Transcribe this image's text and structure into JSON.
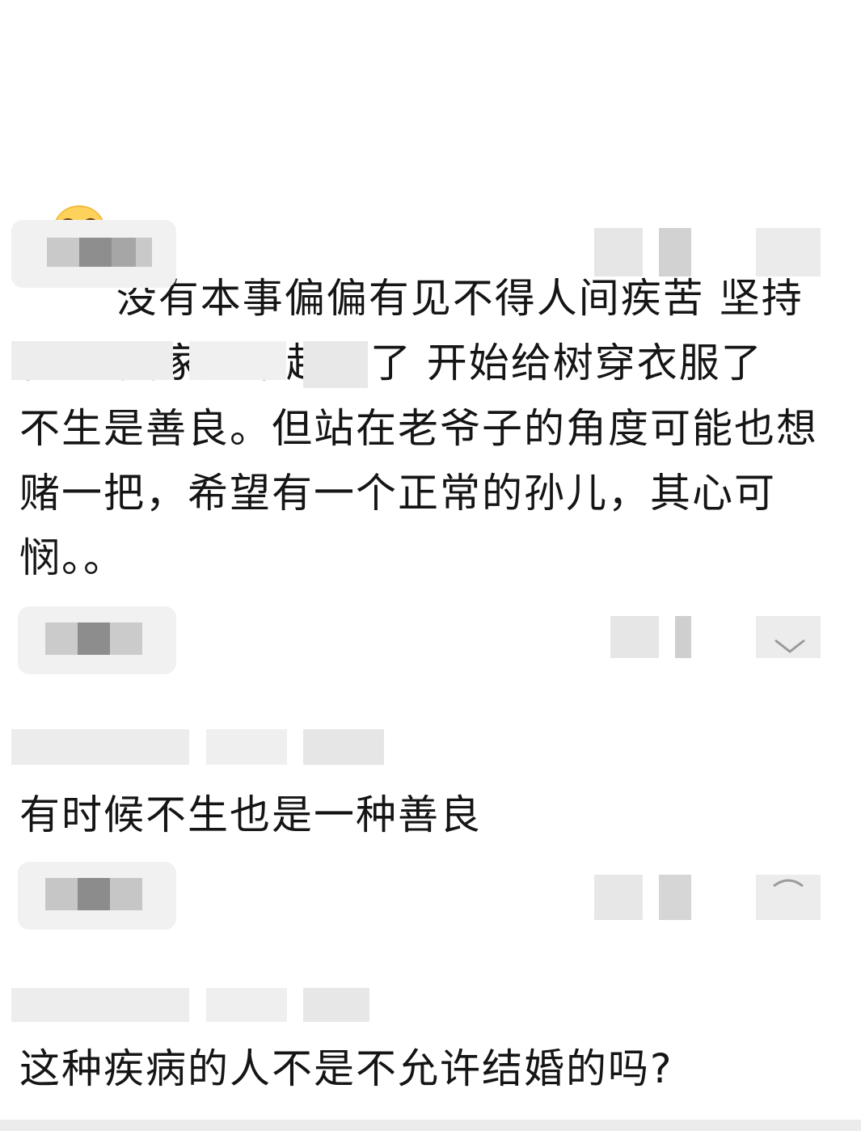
{
  "comments": [
    {
      "emoji": "loudly-crying-face-icon",
      "text": "没有本事偏偏有见不得人间疾苦 坚持住吧 国家越来越好了 开始给树穿衣服了"
    },
    {
      "text": "不生是善良。但站在老爷子的角度可能也想赌一把，希望有一个正常的孙儿，其心可悯。。"
    },
    {
      "text": "有时候不生也是一种善良"
    },
    {
      "text": "这种疾病的人不是不允许结婚的吗?"
    }
  ],
  "colors": {
    "text": "#151515",
    "pill": "#f1f1f1",
    "emoji": "#f6b93b"
  }
}
